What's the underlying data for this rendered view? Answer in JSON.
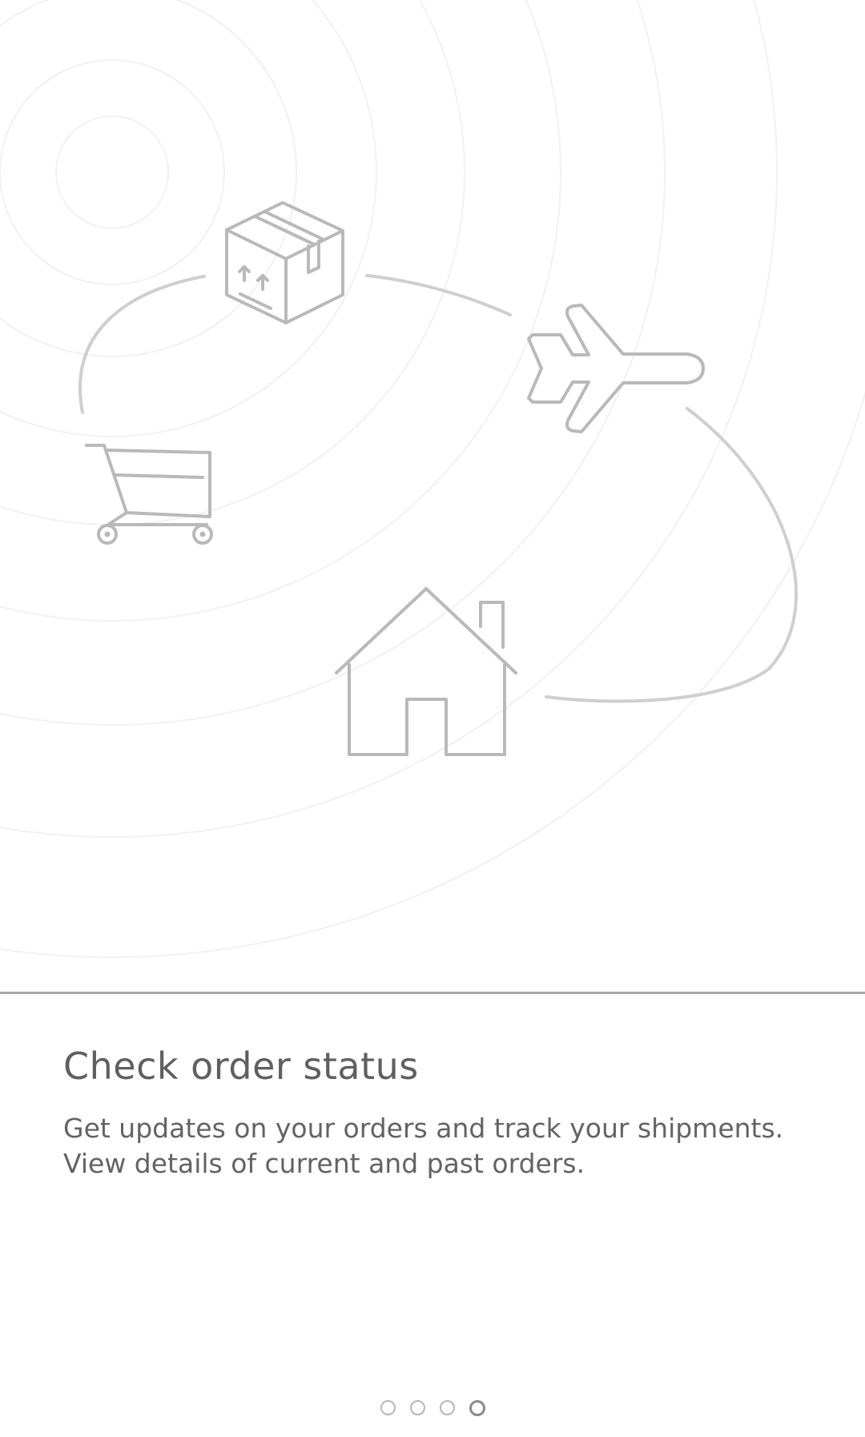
{
  "onboarding": {
    "title": "Check order status",
    "description": "Get updates on your orders and track your shipments. View details of current and past orders.",
    "page_count": 4,
    "current_page": 4
  },
  "illustration": {
    "icons": [
      "package-box-icon",
      "airplane-icon",
      "shopping-cart-icon",
      "house-icon"
    ]
  },
  "colors": {
    "background": "#ffffff",
    "icon_stroke": "#bdbdbd",
    "text_title": "#5f5f5f",
    "text_body": "#636363",
    "divider": "#a8a8a8"
  }
}
